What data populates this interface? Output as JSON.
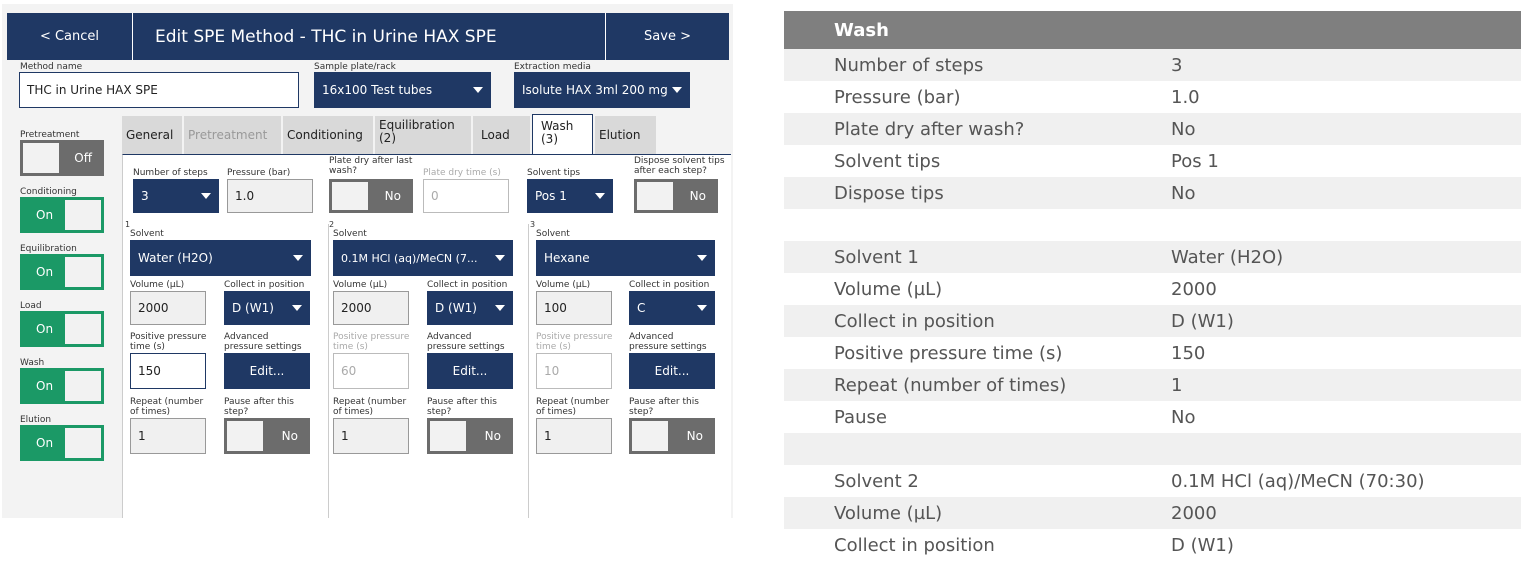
{
  "app": {
    "topbar": {
      "cancel": "< Cancel",
      "title": "Edit SPE Method - THC in Urine HAX SPE",
      "save": "Save >"
    },
    "method_name": {
      "label": "Method name",
      "value": "THC in Urine HAX SPE"
    },
    "sample_plate": {
      "label": "Sample plate/rack",
      "value": "16x100 Test tubes"
    },
    "extraction_media": {
      "label": "Extraction media",
      "value": "Isolute HAX 3ml 200 mg"
    },
    "steps": [
      {
        "label": "Pretreatment",
        "state": "Off"
      },
      {
        "label": "Conditioning",
        "state": "On"
      },
      {
        "label": "Equilibration",
        "state": "On"
      },
      {
        "label": "Load",
        "state": "On"
      },
      {
        "label": "Wash",
        "state": "On"
      },
      {
        "label": "Elution",
        "state": "On"
      }
    ],
    "tabs": {
      "general": "General",
      "pretreatment": "Pretreatment",
      "conditioning": "Conditioning",
      "equilibration": "Equilibration",
      "equilibration_count": "(2)",
      "load": "Load",
      "wash": "Wash",
      "wash_count": "(3)",
      "elution": "Elution"
    },
    "wash": {
      "num_steps_label": "Number of steps",
      "num_steps": "3",
      "pressure_label": "Pressure (bar)",
      "pressure": "1.0",
      "plate_dry_label": "Plate dry after last wash?",
      "plate_dry": "No",
      "plate_dry_time_label": "Plate dry time (s)",
      "plate_dry_time": "0",
      "solvent_tips_label": "Solvent tips",
      "solvent_tips": "Pos 1",
      "dispose_label": "Dispose solvent tips after each step?",
      "dispose": "No",
      "field_labels": {
        "solvent": "Solvent",
        "volume": "Volume (µL)",
        "collect": "Collect in position",
        "pp_time": "Positive pressure time (s)",
        "adv": "Advanced pressure settings",
        "edit": "Edit...",
        "repeat": "Repeat (number of times)",
        "pause": "Pause after this step?"
      },
      "columns": [
        {
          "num": "1",
          "solvent": "Water (H2O)",
          "volume": "2000",
          "collect": "D (W1)",
          "pp_time": "150",
          "repeat": "1",
          "pause": "No"
        },
        {
          "num": "2",
          "solvent": "0.1M HCl (aq)/MeCN (7...",
          "volume": "2000",
          "collect": "D (W1)",
          "pp_time": "60",
          "repeat": "1",
          "pause": "No"
        },
        {
          "num": "3",
          "solvent": "Hexane",
          "volume": "100",
          "collect": "C",
          "pp_time": "10",
          "repeat": "1",
          "pause": "No"
        }
      ]
    }
  },
  "table": {
    "header": "Wash",
    "rows": [
      {
        "k": "Number of steps",
        "v": "3"
      },
      {
        "k": "Pressure (bar)",
        "v": "1.0"
      },
      {
        "k": "Plate dry after wash?",
        "v": "No"
      },
      {
        "k": "Solvent tips",
        "v": "Pos 1"
      },
      {
        "k": "Dispose tips",
        "v": "No"
      },
      {
        "k": "",
        "v": ""
      },
      {
        "k": "Solvent 1",
        "v": "Water (H2O)"
      },
      {
        "k": "Volume (µL)",
        "v": "2000"
      },
      {
        "k": "Collect in position",
        "v": "D (W1)"
      },
      {
        "k": "Positive pressure time (s)",
        "v": "150"
      },
      {
        "k": "Repeat (number of times)",
        "v": "1"
      },
      {
        "k": "Pause",
        "v": "No"
      },
      {
        "k": "",
        "v": ""
      },
      {
        "k": "Solvent 2",
        "v": "0.1M HCl (aq)/MeCN (70:30)"
      },
      {
        "k": "Volume (µL)",
        "v": "2000"
      },
      {
        "k": "Collect in position",
        "v": "D (W1)"
      }
    ]
  }
}
